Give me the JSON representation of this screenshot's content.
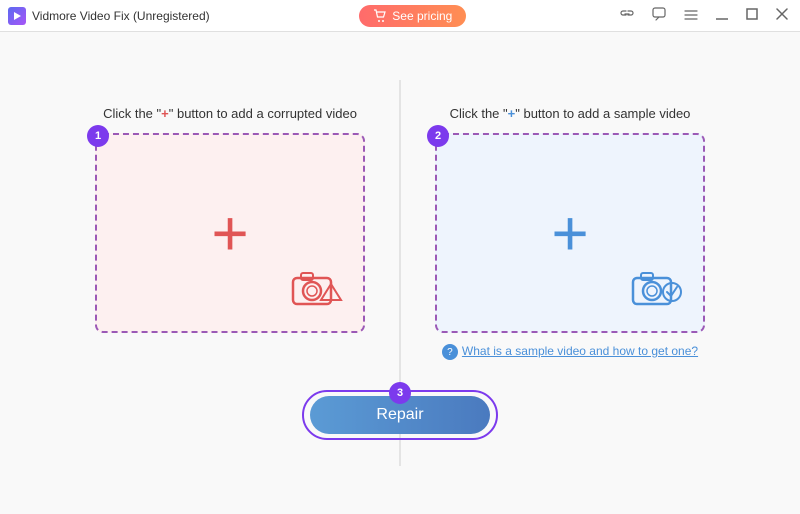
{
  "titleBar": {
    "title": "Vidmore Video Fix (Unregistered)",
    "seePricingLabel": "See pricing",
    "icons": {
      "link": "🔗",
      "chat": "💬",
      "menu": "☰",
      "minimize": "—",
      "maximize": "□",
      "close": "✕"
    }
  },
  "leftPanel": {
    "stepNumber": "1",
    "title1": "Click the \"",
    "plus": "+",
    "title2": "\" button to add a corrupted video"
  },
  "rightPanel": {
    "stepNumber": "2",
    "title1": "Click the \"",
    "plus": "+",
    "title2": "\" button to add a sample video",
    "helpText": "What is a sample video and how to get one?"
  },
  "repairBtn": {
    "stepNumber": "3",
    "label": "Repair"
  }
}
